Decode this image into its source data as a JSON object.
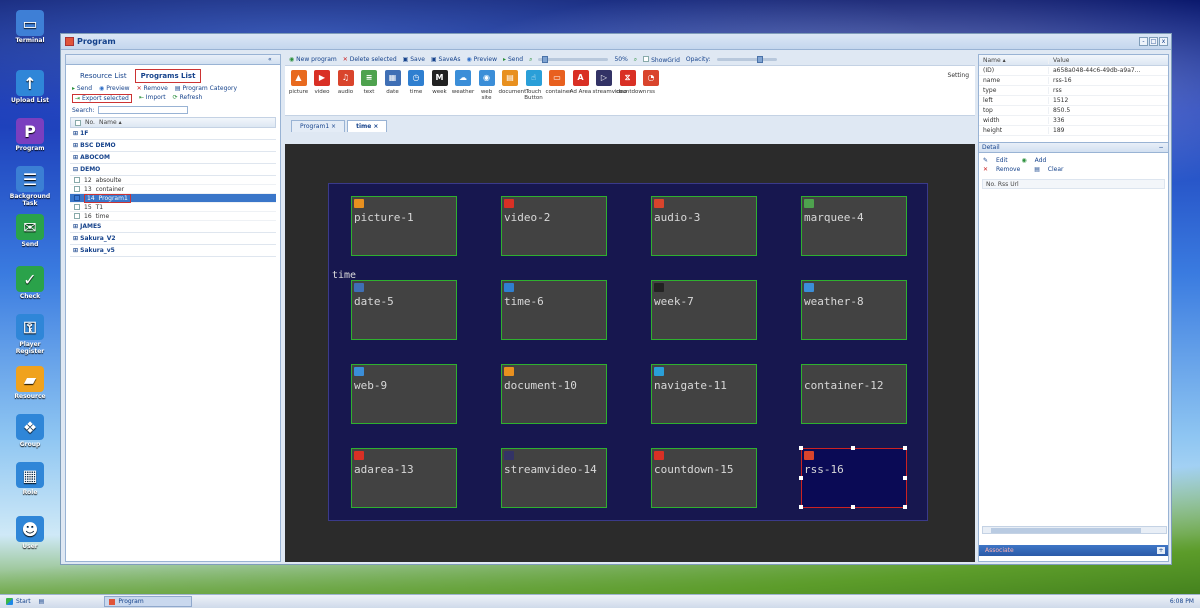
{
  "desktop": {
    "icons": [
      {
        "label": "Terminal",
        "icon": "monitor-icon",
        "color": "#3e7fd6"
      },
      {
        "label": "Upload List",
        "icon": "upload-icon",
        "color": "#2f86d8"
      },
      {
        "label": "Program",
        "icon": "program-icon",
        "color": "#7a3fbf"
      },
      {
        "label": "Background Task",
        "icon": "task-icon",
        "color": "#3b7fd4"
      },
      {
        "label": "Send",
        "icon": "send-icon",
        "color": "#2aa24a"
      },
      {
        "label": "Check",
        "icon": "check-icon",
        "color": "#2aa24a"
      },
      {
        "label": "Player Register",
        "icon": "key-icon",
        "color": "#2f86d8"
      },
      {
        "label": "Resource",
        "icon": "folder-icon",
        "color": "#f0a21d"
      },
      {
        "label": "Group",
        "icon": "group-icon",
        "color": "#2f86d8"
      },
      {
        "label": "Role",
        "icon": "role-icon",
        "color": "#2f86d8"
      },
      {
        "label": "User",
        "icon": "user-icon",
        "color": "#2f86d8"
      }
    ]
  },
  "window": {
    "title": "Program",
    "min": "-",
    "max": "□",
    "close": "x"
  },
  "left": {
    "tabs": [
      "Resource List",
      "Programs List"
    ],
    "toolbar": {
      "send": "Send",
      "preview": "Preview",
      "remove": "Remove",
      "category": "Program Category",
      "export": "Export selected",
      "import": "Import",
      "refresh": "Refresh"
    },
    "search_label": "Search:",
    "grid_head": {
      "no": "No.",
      "name": "Name ▴"
    },
    "groups": [
      {
        "name": "⊞ 1F",
        "items": []
      },
      {
        "name": "⊞ BSC DEMO",
        "items": []
      },
      {
        "name": "⊞ ABOCOM",
        "items": []
      },
      {
        "name": "⊟ DEMO",
        "items": [
          {
            "no": "12",
            "name": "absoulte",
            "checked": false,
            "selected": false
          },
          {
            "no": "13",
            "name": "container",
            "checked": false,
            "selected": false
          },
          {
            "no": "14",
            "name": "Program1",
            "checked": true,
            "selected": true
          },
          {
            "no": "15",
            "name": "T1",
            "checked": false,
            "selected": false
          },
          {
            "no": "16",
            "name": "time",
            "checked": false,
            "selected": false
          }
        ]
      },
      {
        "name": "⊞ JAMES",
        "items": []
      },
      {
        "name": "⊞ Sakura_V2",
        "items": []
      },
      {
        "name": "⊞ Sakura_v5",
        "items": []
      }
    ]
  },
  "center": {
    "toolbar": {
      "new": "New program",
      "delete": "Delete selected",
      "save": "Save",
      "saveas": "SaveAs",
      "preview": "Preview",
      "send": "Send",
      "zoom": "50%",
      "showgrid": "ShowGrid",
      "opacity": "Opacity:"
    },
    "palette": [
      {
        "label": "picture",
        "icon": "picture-icon",
        "color": "#e86a1f",
        "glyph": "▲"
      },
      {
        "label": "video",
        "icon": "video-icon",
        "color": "#d93025",
        "glyph": "▶"
      },
      {
        "label": "audio",
        "icon": "audio-icon",
        "color": "#d9442c",
        "glyph": "♫"
      },
      {
        "label": "text",
        "icon": "text-icon",
        "color": "#4ea24e",
        "glyph": "≡"
      },
      {
        "label": "date",
        "icon": "date-icon",
        "color": "#3f6fb5",
        "glyph": "▦"
      },
      {
        "label": "time",
        "icon": "time-icon",
        "color": "#2f7fd0",
        "glyph": "◷"
      },
      {
        "label": "week",
        "icon": "week-icon",
        "color": "#222222",
        "glyph": "M"
      },
      {
        "label": "weather",
        "icon": "weather-icon",
        "color": "#3b8ed8",
        "glyph": "☁"
      },
      {
        "label": "web site",
        "icon": "website-icon",
        "color": "#3b8ed8",
        "glyph": "◉"
      },
      {
        "label": "document",
        "icon": "document-icon",
        "color": "#e8901f",
        "glyph": "▤"
      },
      {
        "label": "Touch Button",
        "icon": "touch-icon",
        "color": "#2a9fd8",
        "glyph": "☝"
      },
      {
        "label": "container",
        "icon": "container-icon",
        "color": "#e8601f",
        "glyph": "▭"
      },
      {
        "label": "Ad Area",
        "icon": "adarea-icon",
        "color": "#d93025",
        "glyph": "A"
      },
      {
        "label": "streamvideo",
        "icon": "streamvideo-icon",
        "color": "#333366",
        "glyph": "▷"
      },
      {
        "label": "countdown",
        "icon": "countdown-icon",
        "color": "#d93025",
        "glyph": "⧖"
      },
      {
        "label": "rss",
        "icon": "rss-icon",
        "color": "#d9442c",
        "glyph": "◔"
      }
    ],
    "setting": "Setting",
    "doc_tabs": [
      "Program1 ×",
      "time ×"
    ],
    "time_label": "time",
    "widgets": [
      {
        "label": "picture-1",
        "icon": "picture-icon",
        "color": "#e8901f"
      },
      {
        "label": "video-2",
        "icon": "video-icon",
        "color": "#d93025"
      },
      {
        "label": "audio-3",
        "icon": "audio-icon",
        "color": "#d9442c"
      },
      {
        "label": "marquee-4",
        "icon": "marquee-icon",
        "color": "#4ea24e"
      },
      {
        "label": "date-5",
        "icon": "date-icon",
        "color": "#3f6fb5"
      },
      {
        "label": "time-6",
        "icon": "time-icon",
        "color": "#2f7fd0"
      },
      {
        "label": "week-7",
        "icon": "week-icon",
        "color": "#222222"
      },
      {
        "label": "weather-8",
        "icon": "weather-icon",
        "color": "#3b8ed8"
      },
      {
        "label": "web-9",
        "icon": "web-icon",
        "color": "#3b8ed8"
      },
      {
        "label": "document-10",
        "icon": "document-icon",
        "color": "#e8901f"
      },
      {
        "label": "navigate-11",
        "icon": "navigate-icon",
        "color": "#2a9fd8"
      },
      {
        "label": "container-12",
        "icon": "",
        "color": ""
      },
      {
        "label": "adarea-13",
        "icon": "adarea-icon",
        "color": "#d93025"
      },
      {
        "label": "streamvideo-14",
        "icon": "streamvideo-icon",
        "color": "#333366"
      },
      {
        "label": "countdown-15",
        "icon": "countdown-icon",
        "color": "#d93025"
      },
      {
        "label": "rss-16",
        "icon": "rss-icon",
        "color": "#d9442c"
      }
    ]
  },
  "right": {
    "head": {
      "name": "Name ▴",
      "value": "Value"
    },
    "props": [
      {
        "k": "(ID)",
        "v": "a658a048-44c6-49db-a9a7..."
      },
      {
        "k": "name",
        "v": "rss-16"
      },
      {
        "k": "type",
        "v": "rss"
      },
      {
        "k": "left",
        "v": "1512"
      },
      {
        "k": "top",
        "v": "850.5"
      },
      {
        "k": "width",
        "v": "336"
      },
      {
        "k": "height",
        "v": "189"
      }
    ],
    "detail": "Detail",
    "detail_tools": {
      "edit": "Edit",
      "add": "Add",
      "remove": "Remove",
      "clear": "Clear"
    },
    "detail_head": "No. Rss Url",
    "associate": "Associate"
  },
  "taskbar": {
    "start": "Start",
    "task": "Program",
    "clock": "6:08 PM"
  }
}
